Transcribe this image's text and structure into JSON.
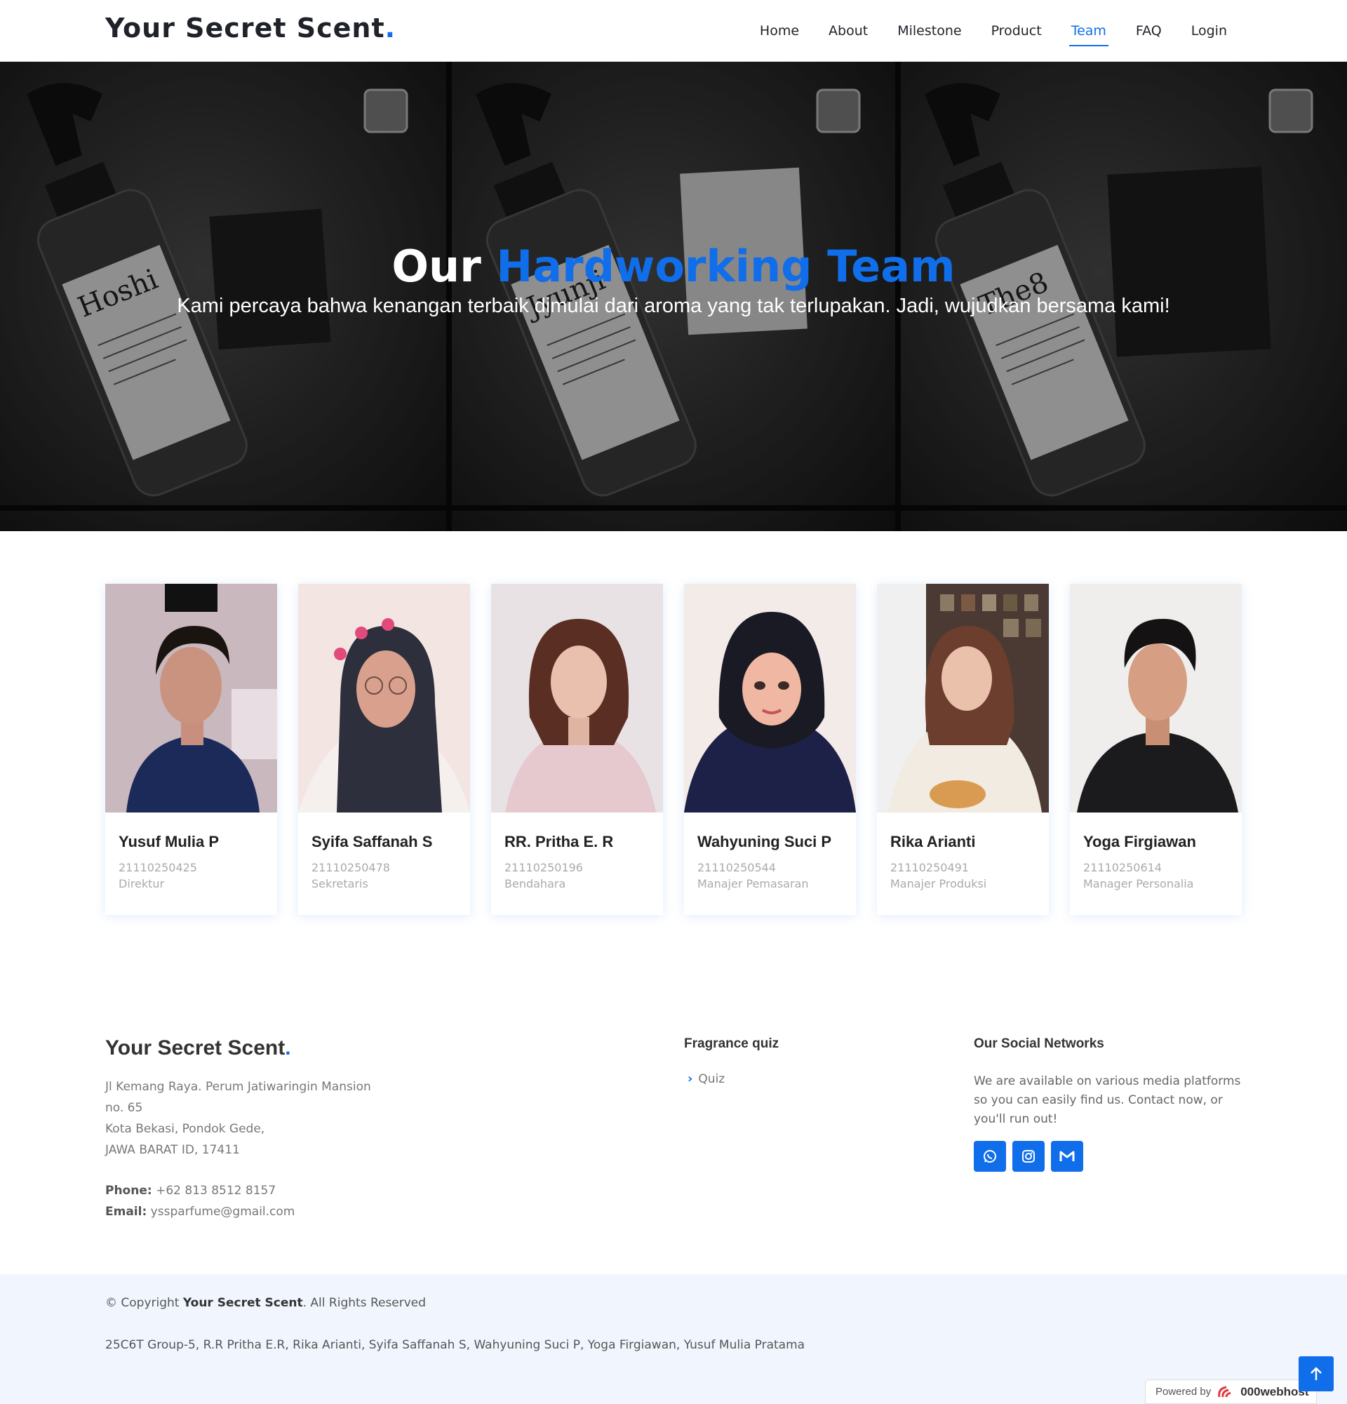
{
  "header": {
    "logo_text": "Your Secret Scent",
    "logo_dot": ".",
    "nav": [
      {
        "label": "Home"
      },
      {
        "label": "About"
      },
      {
        "label": "Milestone"
      },
      {
        "label": "Product"
      },
      {
        "label": "Team",
        "active": true
      },
      {
        "label": "FAQ"
      },
      {
        "label": "Login"
      }
    ]
  },
  "hero": {
    "title_plain": "Our",
    "title_accent": "Hardworking Team",
    "subtitle": "Kami percaya bahwa kenangan terbaik dimulai dari aroma yang tak terlupakan. Jadi, wujudkan bersama kami!",
    "bottle_labels": [
      "Hoshi",
      "Jyunji",
      "The8"
    ]
  },
  "team": [
    {
      "name": "Yusuf Mulia P",
      "nim": "21110250425",
      "role": "Direktur"
    },
    {
      "name": "Syifa Saffanah S",
      "nim": "21110250478",
      "role": "Sekretaris"
    },
    {
      "name": "RR. Pritha E. R",
      "nim": "21110250196",
      "role": "Bendahara"
    },
    {
      "name": "Wahyuning Suci P",
      "nim": "21110250544",
      "role": "Manajer Pemasaran"
    },
    {
      "name": "Rika Arianti",
      "nim": "21110250491",
      "role": "Manajer Produksi"
    },
    {
      "name": "Yoga Firgiawan",
      "nim": "21110250614",
      "role": "Manager Personalia"
    }
  ],
  "footer": {
    "brand": "Your Secret Scent",
    "brand_dot": ".",
    "address_lines": [
      "Jl Kemang Raya. Perum Jatiwaringin Mansion",
      "no. 65",
      "Kota Bekasi, Pondok Gede,",
      "JAWA BARAT ID, 17411"
    ],
    "phone_label": "Phone:",
    "phone": "+62 813 8512 8157",
    "email_label": "Email:",
    "email": "yssparfume@gmail.com",
    "quiz_title": "Fragrance quiz",
    "quiz_link": "Quiz",
    "social_title": "Our Social Networks",
    "social_text": "We are available on various media platforms so you can easily find us. Contact now, or you'll run out!",
    "socials": [
      "whatsapp-icon",
      "instagram-icon",
      "gmail-icon"
    ]
  },
  "bottom": {
    "copyright_prefix": "© Copyright",
    "copyright_brand": "Your Secret Scent",
    "copyright_suffix": ". All Rights Reserved",
    "credits": "25C6T Group-5, R.R Pritha E.R, Rika Arianti, Syifa Saffanah S, Wahyuning Suci P, Yoga Firgiawan, Yusuf Mulia Pratama",
    "powered_by": "Powered by",
    "powered_brand": "000webhost"
  },
  "colors": {
    "accent": "#106eea",
    "bottom_bg": "#f1f6fe"
  }
}
